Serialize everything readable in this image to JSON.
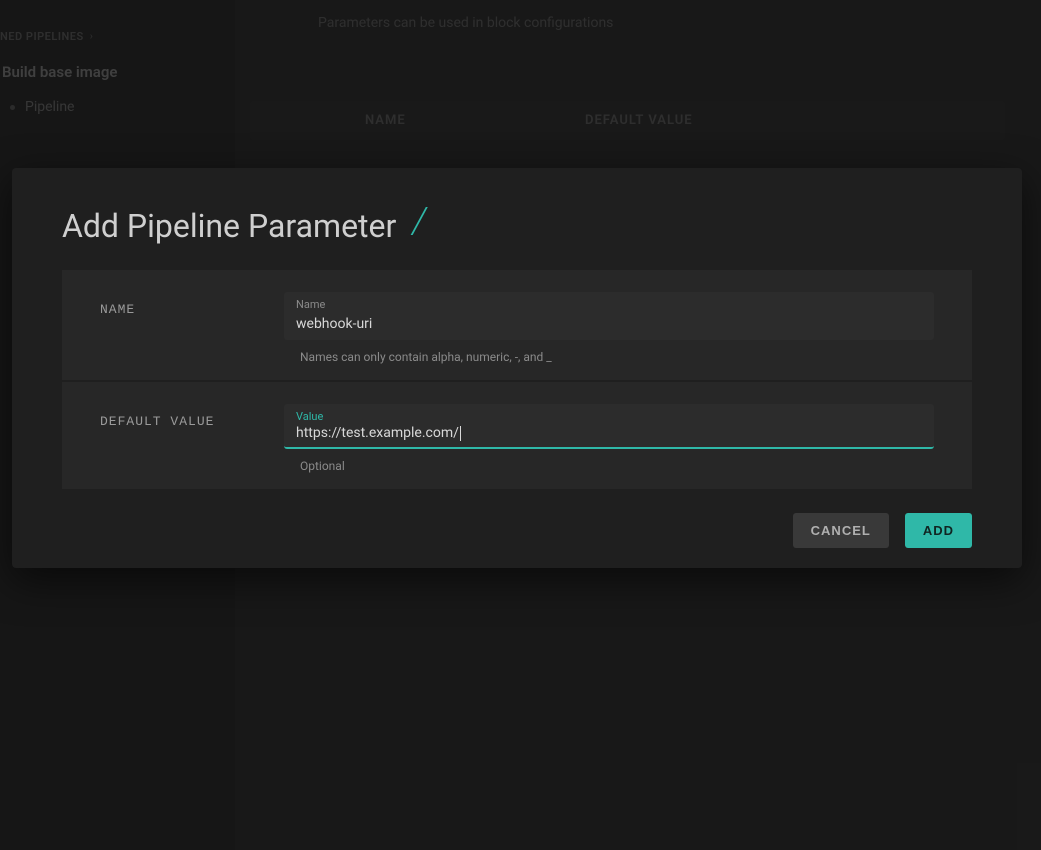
{
  "sidebar": {
    "section_label": "NED PIPELINES",
    "pipeline_name": "Build base image",
    "items": [
      {
        "label": "Pipeline"
      }
    ]
  },
  "main": {
    "hint": "Parameters can be used in block configurations",
    "table_headers": {
      "name": "NAME",
      "default_value": "DEFAULT VALUE"
    }
  },
  "modal": {
    "title": "Add Pipeline Parameter",
    "fields": {
      "name": {
        "label": "NAME",
        "float_label": "Name",
        "value": "webhook-uri",
        "helper": "Names can only contain alpha, numeric, -, and _"
      },
      "default_value": {
        "label": "DEFAULT VALUE",
        "float_label": "Value",
        "value": "https://test.example.com/",
        "helper": "Optional"
      }
    },
    "buttons": {
      "cancel": "CANCEL",
      "add": "ADD"
    }
  }
}
